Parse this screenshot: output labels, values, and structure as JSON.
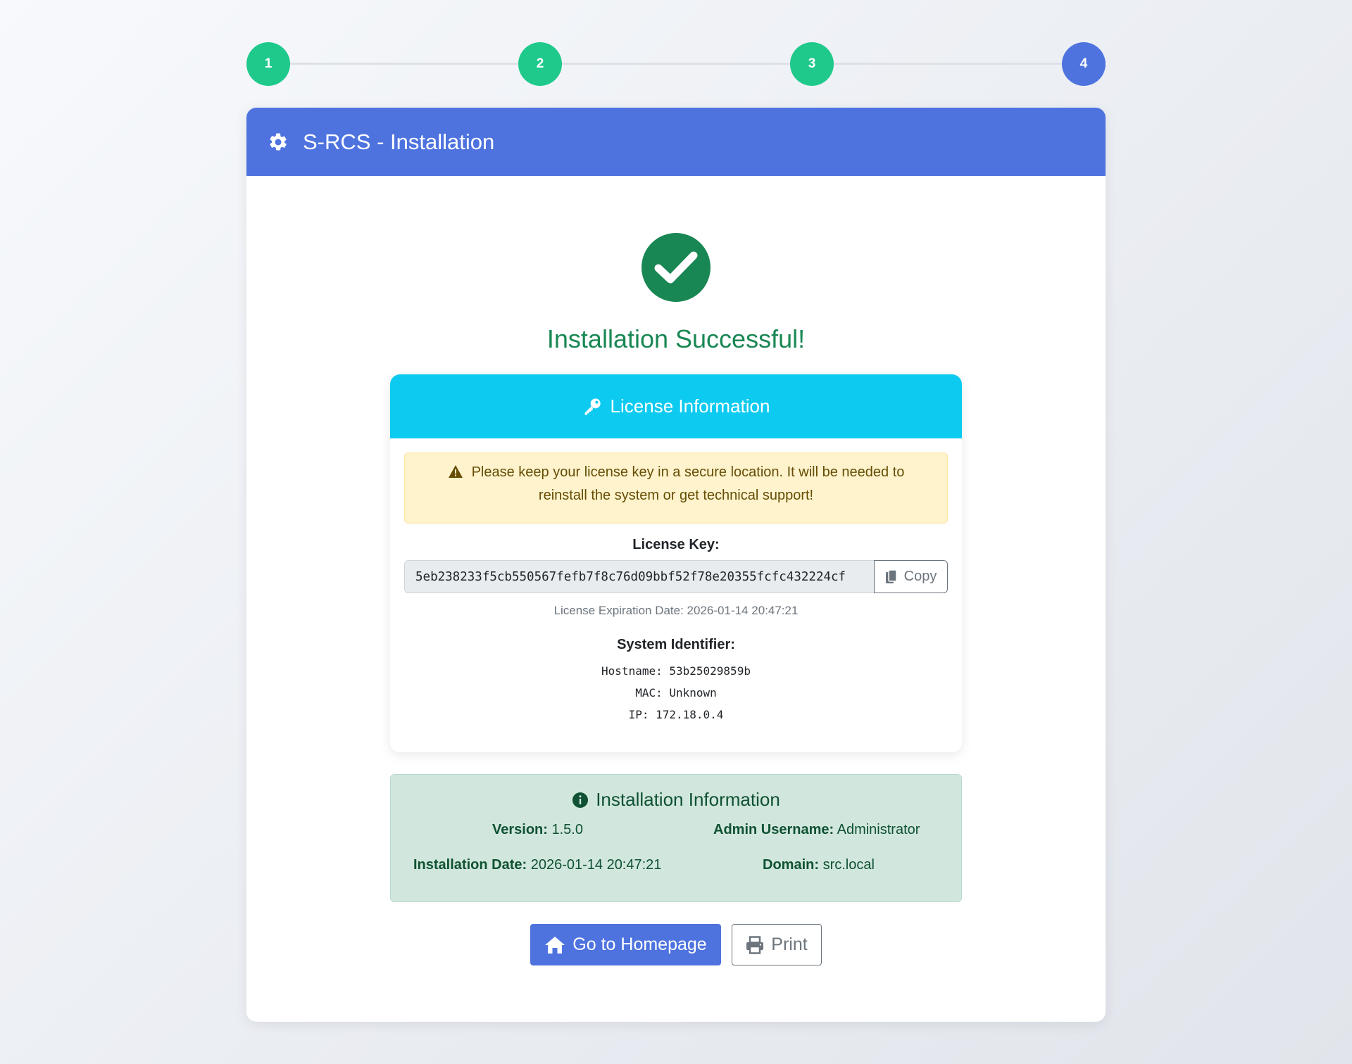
{
  "stepper": {
    "steps": [
      {
        "label": "1",
        "state": "done"
      },
      {
        "label": "2",
        "state": "done"
      },
      {
        "label": "3",
        "state": "done"
      },
      {
        "label": "4",
        "state": "active"
      }
    ],
    "colors": {
      "done": "#1ec98b",
      "active": "#4e73df"
    }
  },
  "header": {
    "title": "S-RCS - Installation",
    "icon": "gear-icon",
    "color": "#4e73df"
  },
  "success": {
    "title": "Installation Successful!",
    "icon": "check-circle-icon",
    "color": "#198754"
  },
  "license": {
    "header": "License Information",
    "header_icon": "key-icon",
    "warning_icon": "warning-triangle-icon",
    "warning": "Please keep your license key in a secure location. It will be needed to reinstall the system or get technical support!",
    "key_label": "License Key:",
    "key_value": "5eb238233f5cb550567fefb7f8c76d09bbf52f78e20355fcfc432224cf",
    "copy_label": "Copy",
    "copy_icon": "copy-icon",
    "expiration": "License Expiration Date: 2026-01-14 20:47:21",
    "system_label": "System Identifier:",
    "hostname": "Hostname: 53b25029859b",
    "mac": "MAC: Unknown",
    "ip": "IP: 172.18.0.4"
  },
  "install_info": {
    "title": "Installation Information",
    "icon": "info-circle-icon",
    "version_label": "Version:",
    "version_value": "1.5.0",
    "admin_label": "Admin Username:",
    "admin_value": "Administrator",
    "date_label": "Installation Date:",
    "date_value": "2026-01-14 20:47:21",
    "domain_label": "Domain:",
    "domain_value": "src.local"
  },
  "actions": {
    "home_label": "Go to Homepage",
    "home_icon": "home-icon",
    "print_label": "Print",
    "print_icon": "printer-icon"
  }
}
